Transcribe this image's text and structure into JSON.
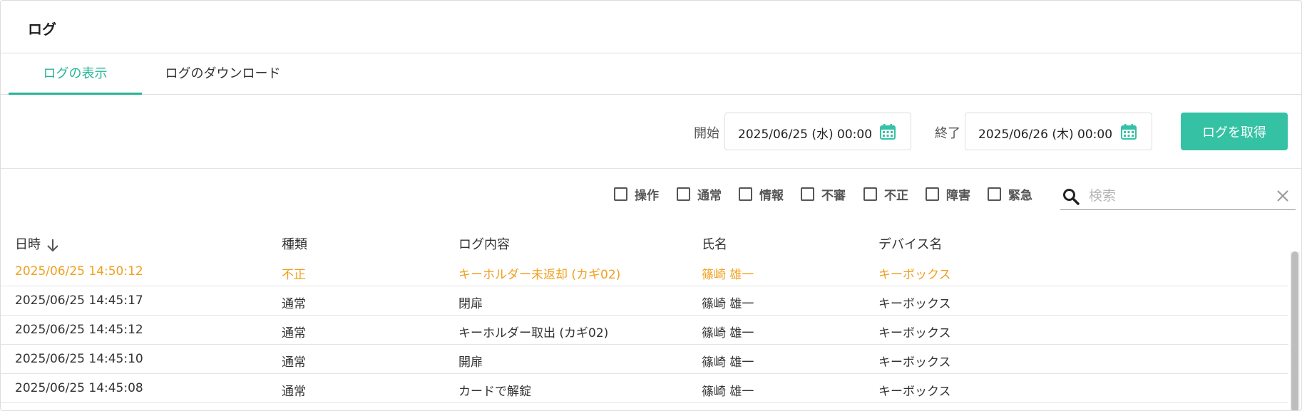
{
  "page": {
    "title": "ログ"
  },
  "tabs": [
    {
      "label": "ログの表示",
      "active": true
    },
    {
      "label": "ログのダウンロード",
      "active": false
    }
  ],
  "range": {
    "start_label": "開始",
    "start_value": "2025/06/25 (水) 00:00",
    "end_label": "終了",
    "end_value": "2025/06/26 (木) 00:00",
    "button_label": "ログを取得"
  },
  "filters": [
    {
      "label": "操作",
      "checked": false
    },
    {
      "label": "通常",
      "checked": false
    },
    {
      "label": "情報",
      "checked": false
    },
    {
      "label": "不審",
      "checked": false
    },
    {
      "label": "不正",
      "checked": false
    },
    {
      "label": "障害",
      "checked": false
    },
    {
      "label": "緊急",
      "checked": false
    }
  ],
  "search": {
    "placeholder": "検索",
    "value": ""
  },
  "table": {
    "columns": [
      "日時",
      "種類",
      "ログ内容",
      "氏名",
      "デバイス名"
    ],
    "rows": [
      {
        "datetime": "2025/06/25 14:50:12",
        "type": "不正",
        "content": "キーホルダー未返却 (カギ02)",
        "name": "篠崎 雄一",
        "device": "キーボックス"
      },
      {
        "datetime": "2025/06/25 14:45:17",
        "type": "通常",
        "content": "閉扉",
        "name": "篠崎 雄一",
        "device": "キーボックス"
      },
      {
        "datetime": "2025/06/25 14:45:12",
        "type": "通常",
        "content": "キーホルダー取出 (カギ02)",
        "name": "篠崎 雄一",
        "device": "キーボックス"
      },
      {
        "datetime": "2025/06/25 14:45:10",
        "type": "通常",
        "content": "開扉",
        "name": "篠崎 雄一",
        "device": "キーボックス"
      },
      {
        "datetime": "2025/06/25 14:45:08",
        "type": "通常",
        "content": "カードで解錠",
        "name": "篠崎 雄一",
        "device": "キーボックス"
      }
    ]
  },
  "colors": {
    "accent": "#35c2a4",
    "warning_text": "#f0a020",
    "border": "#dedede"
  },
  "icons": {
    "calendar": "calendar-icon",
    "search": "search-icon",
    "clear": "close-icon",
    "sort": "arrow-down-icon"
  }
}
